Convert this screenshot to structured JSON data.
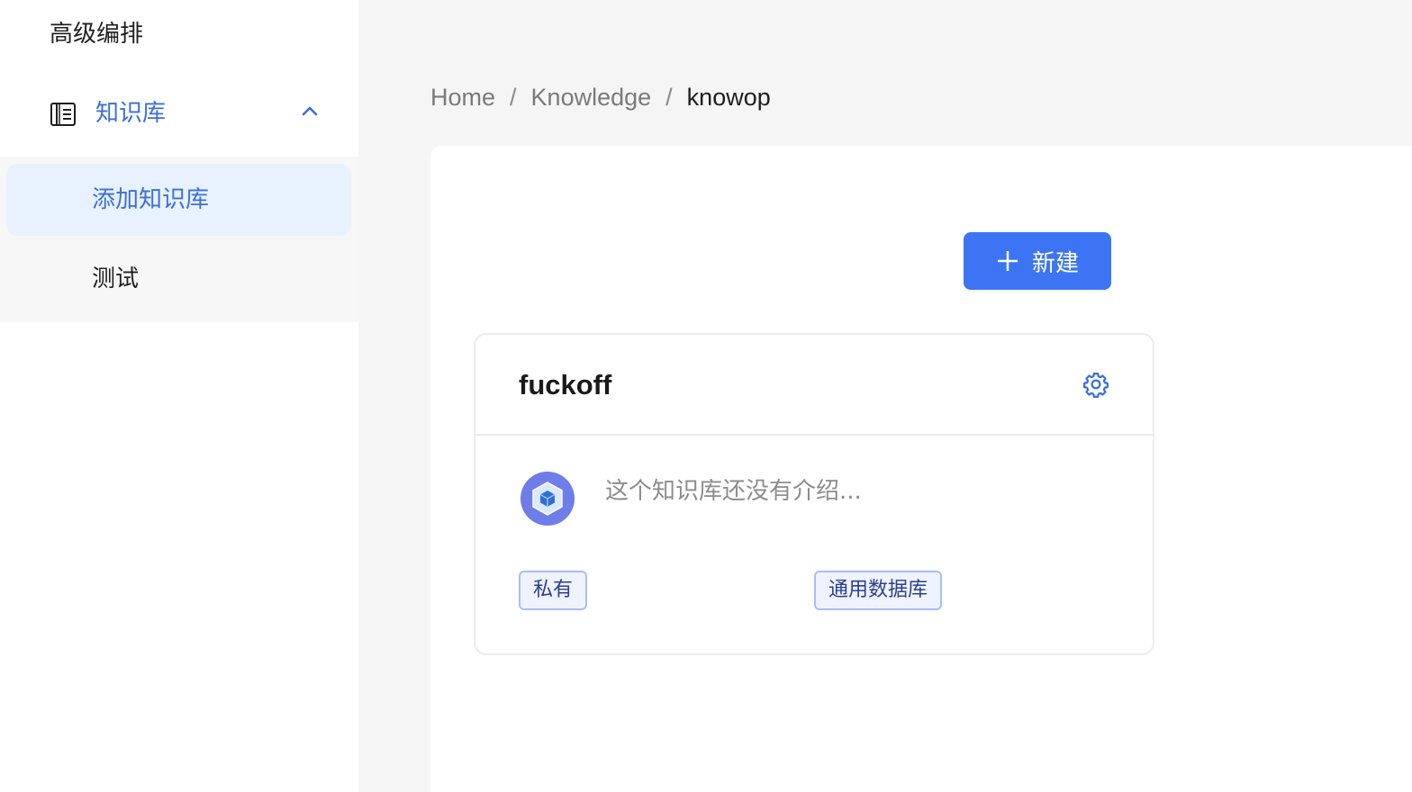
{
  "sidebar": {
    "top_item": "高级编排",
    "group": {
      "label": "知识库",
      "icon": "notebook-icon",
      "expanded": true
    },
    "sub_items": [
      {
        "label": "添加知识库",
        "active": true
      },
      {
        "label": "测试",
        "active": false
      }
    ]
  },
  "breadcrumb": {
    "items": [
      "Home",
      "Knowledge"
    ],
    "current": "knowop",
    "separator": "/"
  },
  "toolbar": {
    "new_label": "新建"
  },
  "card": {
    "title": "fuckoff",
    "description": "这个知识库还没有介绍...",
    "tags": [
      "私有",
      "通用数据库"
    ],
    "avatar_icon": "cube-icon"
  },
  "colors": {
    "accent": "#3c74f4",
    "active_bg": "#e8f2fe",
    "link": "#3b6fd9"
  }
}
